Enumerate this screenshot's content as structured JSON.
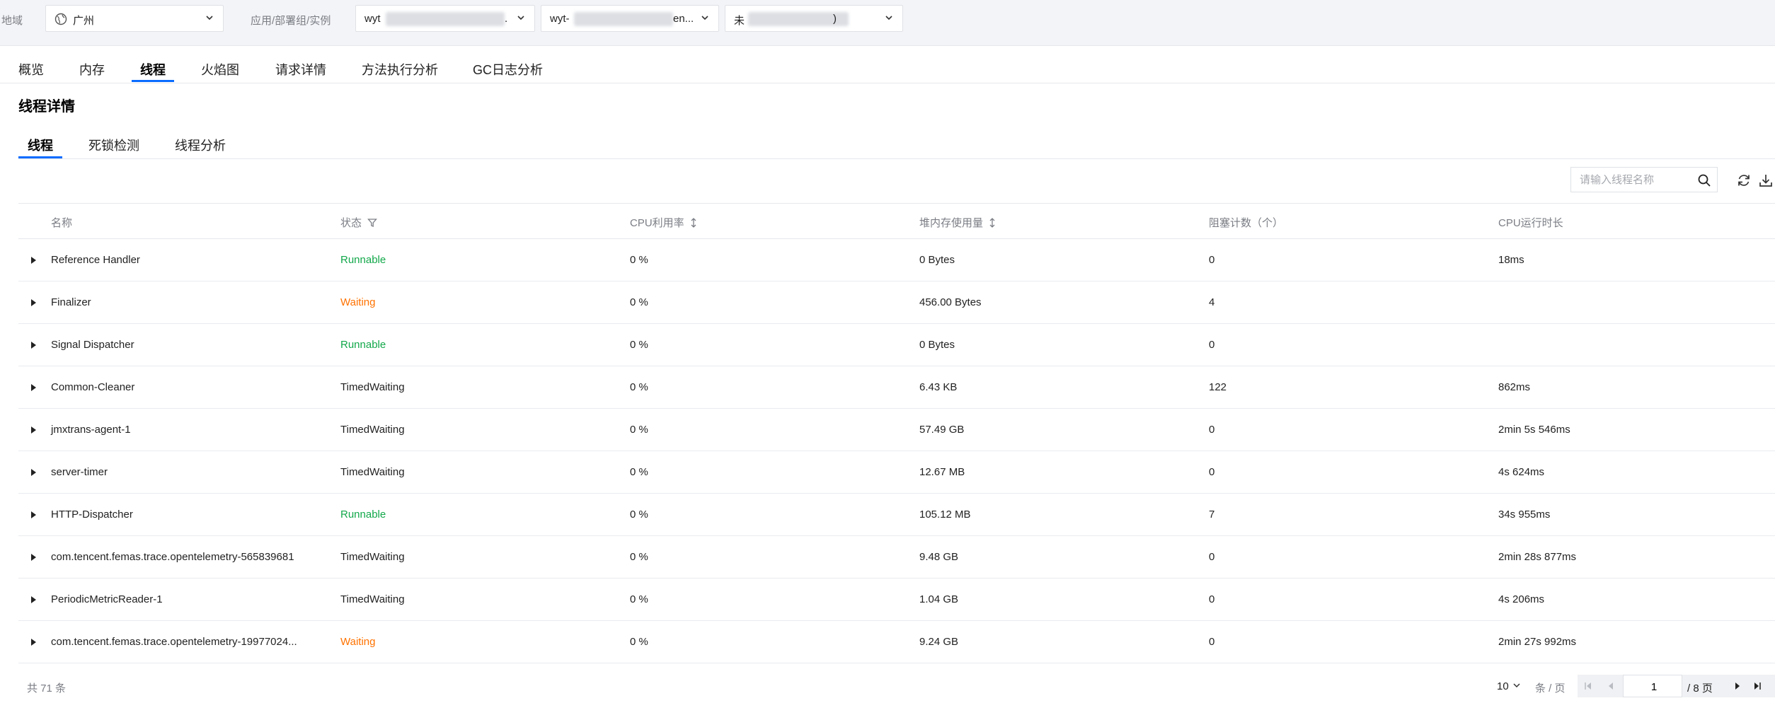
{
  "filters": {
    "region_label": "地域",
    "region_value": "广州",
    "app_label": "应用/部署组/实例",
    "app_value": "wyt",
    "app_value_suffix": ".",
    "group_value": "wyt-",
    "group_value_suffix": "en...",
    "instance_value": "未",
    "instance_value_suffix": ")"
  },
  "main_tabs": [
    {
      "label": "概览"
    },
    {
      "label": "内存"
    },
    {
      "label": "线程"
    },
    {
      "label": "火焰图"
    },
    {
      "label": "请求详情"
    },
    {
      "label": "方法执行分析"
    },
    {
      "label": "GC日志分析"
    }
  ],
  "section_title": "线程详情",
  "sub_tabs": [
    {
      "label": "线程"
    },
    {
      "label": "死锁检测"
    },
    {
      "label": "线程分析"
    }
  ],
  "search": {
    "placeholder": "请输入线程名称"
  },
  "columns": {
    "name": "名称",
    "state": "状态",
    "cpu": "CPU利用率",
    "heap": "堆内存使用量",
    "blocked": "阻塞计数（个）",
    "cpu_time": "CPU运行时长"
  },
  "rows": [
    {
      "name": "Reference Handler",
      "state": "Runnable",
      "cpu": "0 %",
      "heap": "0 Bytes",
      "blocked": "0",
      "cpu_time": "18ms"
    },
    {
      "name": "Finalizer",
      "state": "Waiting",
      "cpu": "0 %",
      "heap": "456.00 Bytes",
      "blocked": "4",
      "cpu_time": ""
    },
    {
      "name": "Signal Dispatcher",
      "state": "Runnable",
      "cpu": "0 %",
      "heap": "0 Bytes",
      "blocked": "0",
      "cpu_time": ""
    },
    {
      "name": "Common-Cleaner",
      "state": "TimedWaiting",
      "cpu": "0 %",
      "heap": "6.43 KB",
      "blocked": "122",
      "cpu_time": "862ms"
    },
    {
      "name": "jmxtrans-agent-1",
      "state": "TimedWaiting",
      "cpu": "0 %",
      "heap": "57.49 GB",
      "blocked": "0",
      "cpu_time": "2min 5s 546ms"
    },
    {
      "name": "server-timer",
      "state": "TimedWaiting",
      "cpu": "0 %",
      "heap": "12.67 MB",
      "blocked": "0",
      "cpu_time": "4s 624ms"
    },
    {
      "name": "HTTP-Dispatcher",
      "state": "Runnable",
      "cpu": "0 %",
      "heap": "105.12 MB",
      "blocked": "7",
      "cpu_time": "34s 955ms"
    },
    {
      "name": "com.tencent.femas.trace.opentelemetry-565839681",
      "state": "TimedWaiting",
      "cpu": "0 %",
      "heap": "9.48 GB",
      "blocked": "0",
      "cpu_time": "2min 28s 877ms"
    },
    {
      "name": "PeriodicMetricReader-1",
      "state": "TimedWaiting",
      "cpu": "0 %",
      "heap": "1.04 GB",
      "blocked": "0",
      "cpu_time": "4s 206ms"
    },
    {
      "name": "com.tencent.femas.trace.opentelemetry-19977024...",
      "state": "Waiting",
      "cpu": "0 %",
      "heap": "9.24 GB",
      "blocked": "0",
      "cpu_time": "2min 27s 992ms"
    }
  ],
  "state_colors": {
    "Runnable": "#12a84a",
    "Waiting": "#ff7200",
    "TimedWaiting": "#222222"
  },
  "accent_color": "#0a6cff",
  "pagination": {
    "total_text": "共 71 条",
    "page_size": "10",
    "per_page_text": "条 / 页",
    "current_page": "1",
    "total_pages_text": "/ 8 页"
  }
}
